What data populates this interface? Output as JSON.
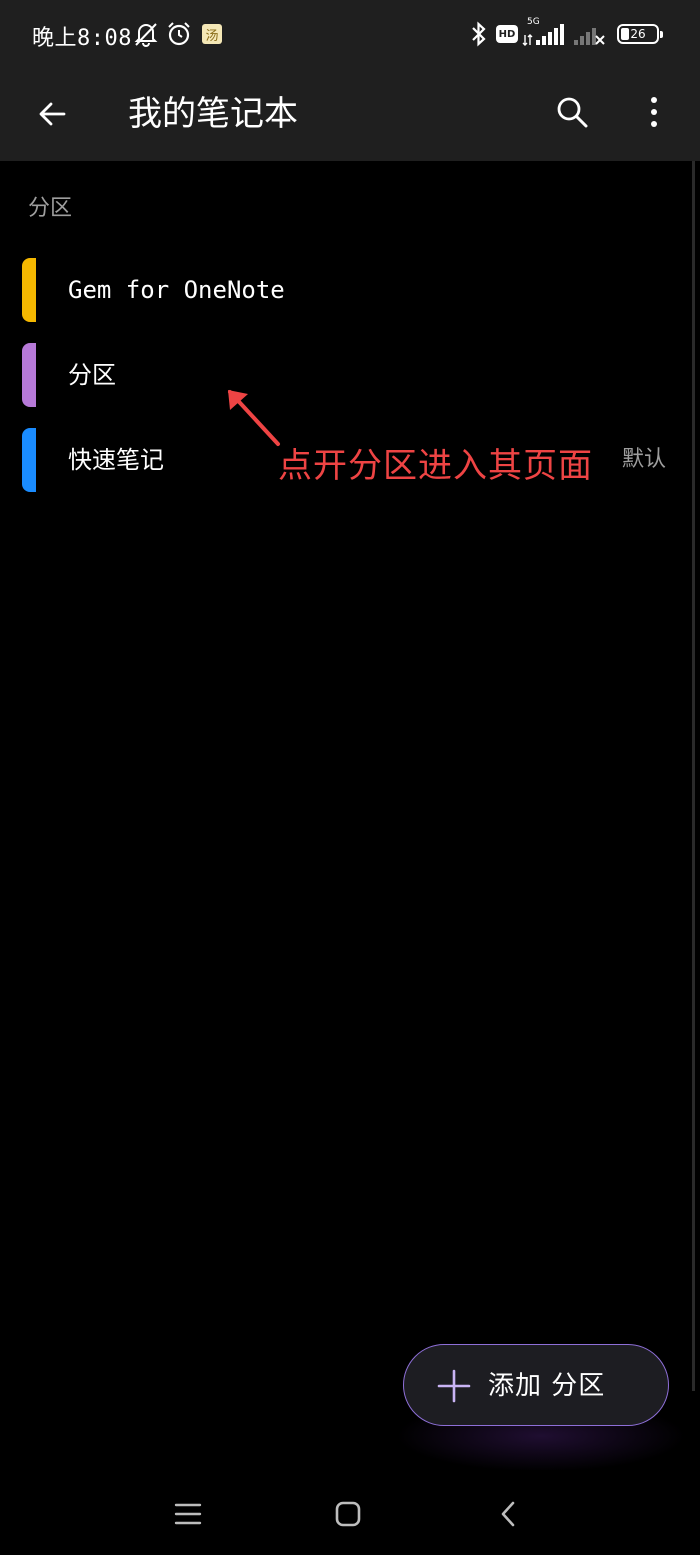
{
  "status_bar": {
    "time": "晚上8:08",
    "app_badge": "汤",
    "hd_label": "HD",
    "network_label": "5G",
    "battery_level": "26",
    "icons": [
      "bell-off-icon",
      "alarm-icon",
      "app-badge-icon",
      "bluetooth-icon",
      "hd-icon",
      "signal-5g-icon",
      "signal-no-sim-icon",
      "battery-icon"
    ]
  },
  "app_bar": {
    "title": "我的笔记本",
    "back_icon": "arrow-left-icon",
    "search_icon": "search-icon",
    "more_icon": "more-vertical-icon"
  },
  "sections": {
    "header": "分区",
    "items": [
      {
        "label": "Gem for OneNote",
        "color": "#f5b800",
        "badge": ""
      },
      {
        "label": "分区",
        "color": "#b679d8",
        "badge": ""
      },
      {
        "label": "快速笔记",
        "color": "#1a8cff",
        "badge": "默认"
      }
    ]
  },
  "annotation": {
    "text": "点开分区进入其页面",
    "color": "#ee4444"
  },
  "fab": {
    "label": "添加 分区",
    "icon": "plus-icon",
    "accent": "#8e6fd8"
  },
  "nav_bar": {
    "icons": [
      "menu-icon",
      "home-square-icon",
      "back-chevron-icon"
    ]
  }
}
